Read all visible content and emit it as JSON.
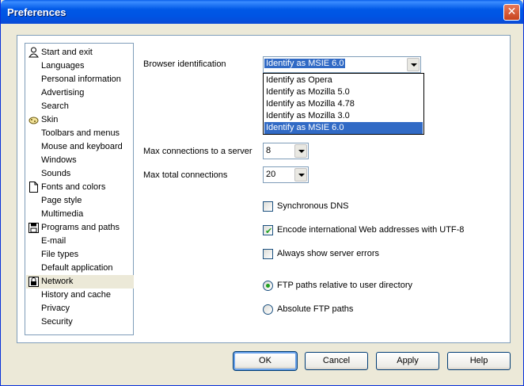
{
  "window": {
    "title": "Preferences",
    "close_glyph": "✕"
  },
  "nav": {
    "items": [
      {
        "label": "Start and exit",
        "icon": "person-icon",
        "top": true
      },
      {
        "label": "Languages"
      },
      {
        "label": "Personal information"
      },
      {
        "label": "Advertising"
      },
      {
        "label": "Search"
      },
      {
        "label": "Skin",
        "icon": "skin-icon",
        "top": true
      },
      {
        "label": "Toolbars and menus"
      },
      {
        "label": "Mouse and keyboard"
      },
      {
        "label": "Windows"
      },
      {
        "label": "Sounds"
      },
      {
        "label": "Fonts and colors",
        "icon": "page-icon",
        "top": true
      },
      {
        "label": "Page style"
      },
      {
        "label": "Multimedia"
      },
      {
        "label": "Programs and paths",
        "icon": "disk-icon",
        "top": true
      },
      {
        "label": "E-mail"
      },
      {
        "label": "File types"
      },
      {
        "label": "Default application"
      },
      {
        "label": "Network",
        "icon": "lock-icon",
        "top": true,
        "selected": true
      },
      {
        "label": "History and cache"
      },
      {
        "label": "Privacy"
      },
      {
        "label": "Security"
      }
    ]
  },
  "network": {
    "browser_id_label": "Browser identification",
    "browser_id_value": "Identify as MSIE 6.0",
    "browser_id_options": [
      "Identify as Opera",
      "Identify as Mozilla 5.0",
      "Identify as Mozilla 4.78",
      "Identify as Mozilla 3.0",
      "Identify as MSIE 6.0"
    ],
    "max_server_label": "Max connections to a server",
    "max_server_value": "8",
    "max_total_label": "Max total connections",
    "max_total_value": "20",
    "sync_dns_label": "Synchronous DNS",
    "sync_dns_checked": false,
    "utf8_label": "Encode international Web addresses with UTF-8",
    "utf8_checked": true,
    "server_errors_label": "Always show server errors",
    "server_errors_checked": false,
    "ftp_relative_label": "FTP paths relative to user directory",
    "ftp_absolute_label": "Absolute FTP paths",
    "ftp_selected": "relative",
    "check_glyph": "✔"
  },
  "buttons": {
    "ok": "OK",
    "cancel": "Cancel",
    "apply": "Apply",
    "help": "Help"
  }
}
